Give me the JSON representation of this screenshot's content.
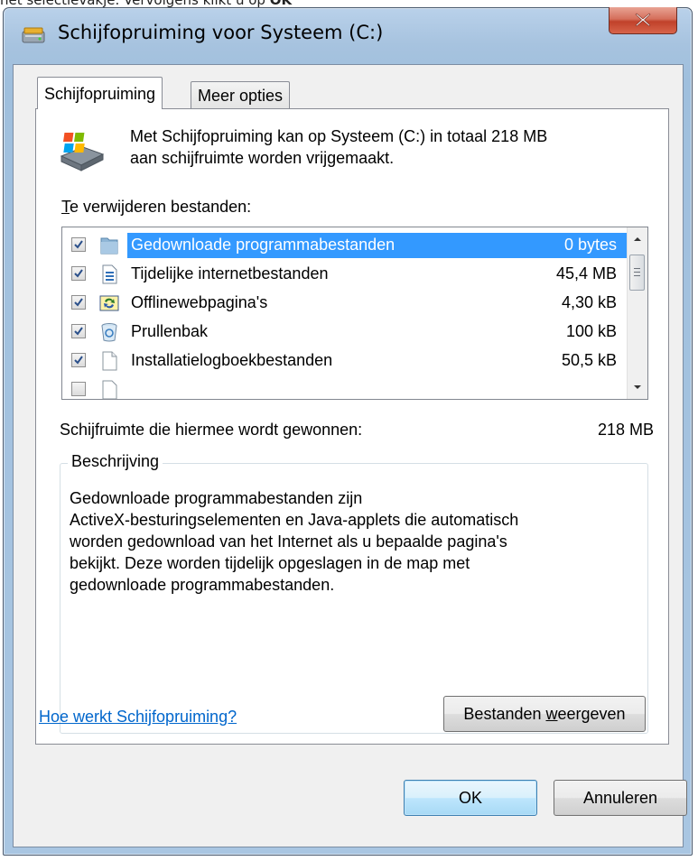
{
  "caption": {
    "text": "het selectievakje. Vervolgens klikt u op",
    "bold": "OK"
  },
  "window": {
    "title": "Schijfopruiming voor Systeem (C:)",
    "close_icon": "close-x-icon"
  },
  "tabs": [
    {
      "label": "Schijfopruiming",
      "active": true
    },
    {
      "label": "Meer opties",
      "active": false
    }
  ],
  "intro": {
    "line1": "Met Schijfopruiming kan op Systeem (C:) in totaal 218 MB",
    "line2": "aan schijfruimte worden vrijgemaakt."
  },
  "files": {
    "label_accel": "T",
    "label_rest": "e verwijderen bestanden:",
    "items": [
      {
        "name": "Gedownloade programmabestanden",
        "size": "0 bytes",
        "checked": true,
        "icon": "folder-icon",
        "selected": true
      },
      {
        "name": "Tijdelijke internetbestanden",
        "size": "45,4 MB",
        "checked": true,
        "icon": "document-icon",
        "selected": false
      },
      {
        "name": "Offlinewebpagina's",
        "size": "4,30 kB",
        "checked": true,
        "icon": "offline-sync-icon",
        "selected": false
      },
      {
        "name": "Prullenbak",
        "size": "100 kB",
        "checked": true,
        "icon": "recycle-bin-icon",
        "selected": false
      },
      {
        "name": "Installatielogboekbestanden",
        "size": "50,5 kB",
        "checked": true,
        "icon": "blank-file-icon",
        "selected": false
      }
    ]
  },
  "gain": {
    "label": "Schijfruimte die hiermee wordt gewonnen:",
    "value": "218 MB"
  },
  "description": {
    "legend": "Beschrijving",
    "lines": [
      "Gedownloade programmabestanden zijn",
      "ActiveX-besturingselementen en Java-applets die automatisch",
      "worden gedownload van het Internet als u bepaalde pagina's",
      "bekijkt. Deze worden tijdelijk opgeslagen in de map met",
      "gedownloade programmabestanden."
    ],
    "view_button_pre": "Bestanden ",
    "view_button_accel": "w",
    "view_button_post": "eergeven"
  },
  "help_link": "Hoe werkt Schijfopruiming?",
  "buttons": {
    "ok": "OK",
    "cancel": "Annuleren"
  }
}
